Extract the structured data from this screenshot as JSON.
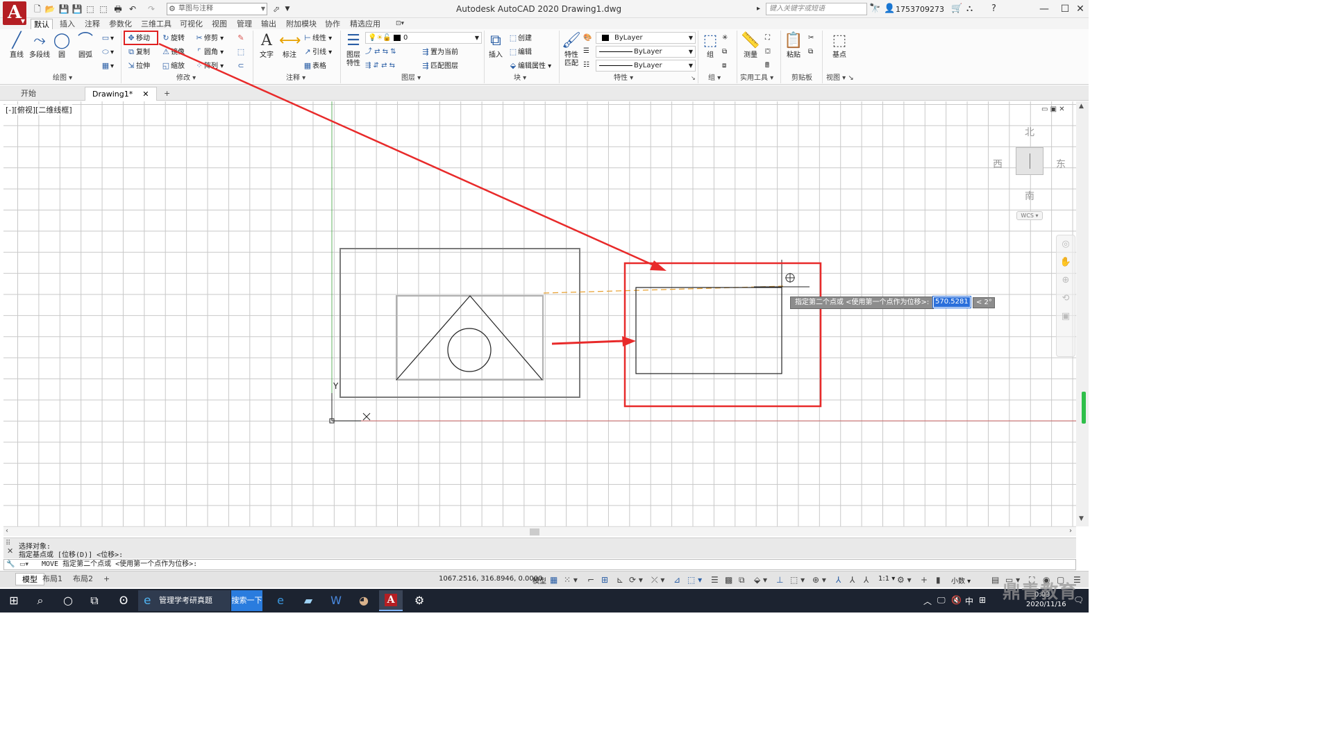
{
  "titlebar": {
    "app_letter": "A",
    "workspace": "草图与注释",
    "title": "Autodesk AutoCAD 2020    Drawing1.dwg",
    "search_placeholder": "键入关键字或短语",
    "user": "1753709273"
  },
  "ribbon_tabs": [
    "默认",
    "插入",
    "注释",
    "参数化",
    "三维工具",
    "可视化",
    "视图",
    "管理",
    "输出",
    "附加模块",
    "协作",
    "精选应用"
  ],
  "ribbon": {
    "draw": {
      "title": "绘图",
      "line": "直线",
      "polyline": "多段线",
      "circle": "圆",
      "arc": "圆弧"
    },
    "modify": {
      "title": "修改",
      "move": "移动",
      "rotate": "旋转",
      "trim": "修剪",
      "copy": "复制",
      "mirror": "镜像",
      "fillet": "圆角",
      "stretch": "拉伸",
      "scale": "缩放",
      "array": "阵列"
    },
    "annotation": {
      "title": "注释",
      "text": "文字",
      "dimension": "标注",
      "linear": "线性",
      "leader": "引线",
      "table": "表格"
    },
    "layers": {
      "title": "图层",
      "layer_props_1": "图层",
      "layer_props_2": "特性",
      "current_layer": "0",
      "make_current": "置为当前",
      "match_layer": "匹配图层"
    },
    "block": {
      "title": "块",
      "insert": "插入",
      "create": "创建",
      "edit": "编辑",
      "edit_attr": "编辑属性"
    },
    "properties": {
      "title": "特性",
      "match_1": "特性",
      "match_2": "匹配",
      "color": "ByLayer",
      "linetype": "ByLayer",
      "lineweight": "ByLayer"
    },
    "groups": {
      "title": "组",
      "group": "组"
    },
    "utilities": {
      "title": "实用工具",
      "measure": "测量"
    },
    "clipboard": {
      "title": "剪贴板",
      "paste": "粘贴"
    },
    "view": {
      "title": "视图",
      "base": "基点"
    }
  },
  "file_tabs": {
    "start": "开始",
    "drawing": "Drawing1*"
  },
  "viewport": {
    "label": "[-][俯视][二维线框]",
    "compass": {
      "north": "北",
      "south": "南",
      "east": "东",
      "west": "西"
    },
    "wcs": "WCS",
    "ucs_x": "X",
    "ucs_y": "Y"
  },
  "dynamic_input": {
    "prompt": "指定第二个点或 <使用第一个点作为位移>:",
    "value": "570.5281",
    "angle": "< 2°"
  },
  "command": {
    "history_1": "选择对象:",
    "history_2": "指定基点或 [位移(D)] <位移>:",
    "current": "MOVE 指定第二个点或 <使用第一个点作为位移>:"
  },
  "statusbar": {
    "layout_tabs": [
      "模型",
      "布局1",
      "布局2"
    ],
    "coords": "1067.2516, 316.8946, 0.0000",
    "model": "模型",
    "scale": "1:1",
    "units": "小数"
  },
  "taskbar": {
    "ie_title": "管理学考研真题",
    "search_btn": "搜索一下",
    "date": "2020/11/16",
    "ime": "中",
    "watermark": "鼎青教育"
  },
  "colors": {
    "accent": "#b41e23",
    "highlight_red": "#e02020",
    "dyn_input_blue": "#2a6fdb",
    "taskbar_bg": "#1c2330"
  }
}
